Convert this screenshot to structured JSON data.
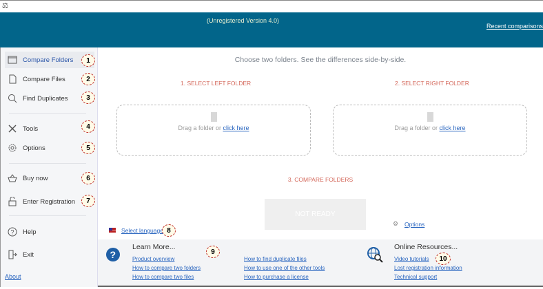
{
  "header": {
    "version": "(Unregistered Version 4.0)",
    "recent": "Recent comparisons"
  },
  "sidebar": {
    "items": [
      {
        "label": "Compare Folders",
        "badge": "1"
      },
      {
        "label": "Compare Files",
        "badge": "2"
      },
      {
        "label": "Find Duplicates",
        "badge": "3"
      },
      {
        "label": "Tools",
        "badge": "4"
      },
      {
        "label": "Options",
        "badge": "5"
      },
      {
        "label": "Buy now",
        "badge": "6"
      },
      {
        "label": "Enter Registration",
        "badge": "7"
      },
      {
        "label": "Help"
      },
      {
        "label": "Exit"
      }
    ],
    "about": "About"
  },
  "main": {
    "subtitle": "Choose two folders. See the differences side-by-side.",
    "step1": "1. SELECT LEFT FOLDER",
    "step2": "2. SELECT RIGHT FOLDER",
    "step3": "3. COMPARE FOLDERS",
    "drag": "Drag a folder or",
    "click": "click here",
    "not_ready": "NOT READY",
    "options": "Options",
    "language": "Select language",
    "badge8": "8"
  },
  "bottom": {
    "learn_title": "Learn More...",
    "badge9": "9",
    "learn_links": [
      "Product overview",
      "How to compare two folders",
      "How to compare two files",
      "How to find duplicate files",
      "How to use one of the other tools",
      "How to purchase a license"
    ],
    "online_title": "Online Resources...",
    "badge10": "10",
    "online_links": [
      "Video tutorials",
      "Lost registration information",
      "Technical support"
    ]
  },
  "colors": {
    "header": "#02658a",
    "accent": "#2a66c0",
    "step": "#d4675a"
  }
}
